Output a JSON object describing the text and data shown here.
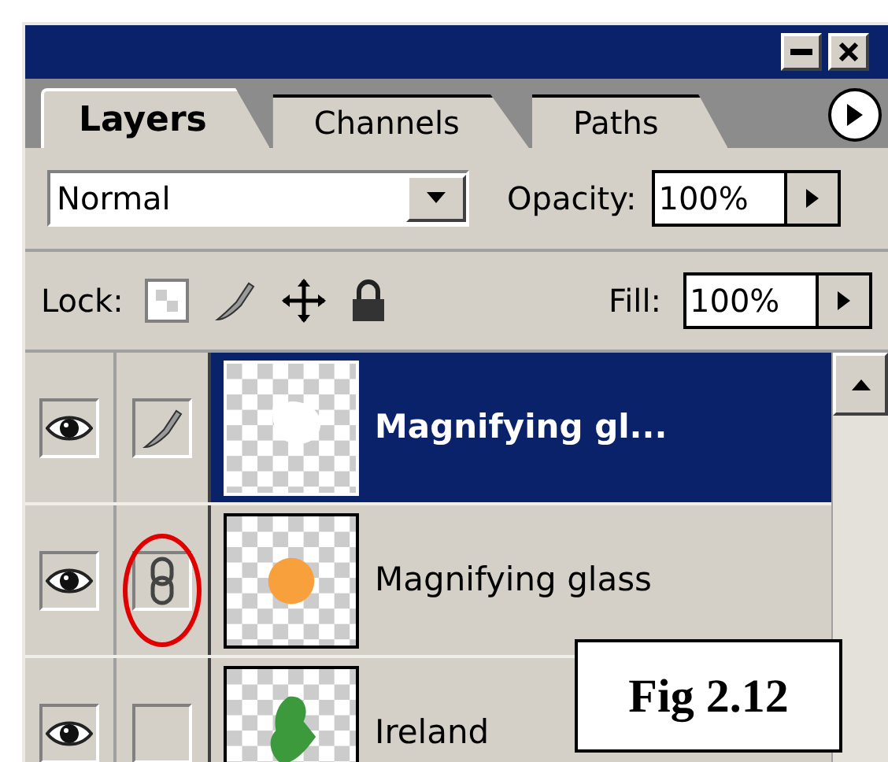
{
  "tabs": [
    {
      "label": "Layers",
      "selected": true
    },
    {
      "label": "Channels",
      "selected": false
    },
    {
      "label": "Paths",
      "selected": false
    }
  ],
  "blend_mode": {
    "value": "Normal"
  },
  "opacity": {
    "label": "Opacity:",
    "value": "100%"
  },
  "lock": {
    "label": "Lock:"
  },
  "fill": {
    "label": "Fill:",
    "value": "100%"
  },
  "layers": [
    {
      "name": "Magnifying gl...",
      "selected": true,
      "visible": true,
      "status": {
        "kind": "brush"
      },
      "thumbnail": {
        "kind": "white"
      },
      "circled": false
    },
    {
      "name": "Magnifying glass",
      "selected": false,
      "visible": true,
      "status": {
        "kind": "link"
      },
      "thumbnail": {
        "kind": "dot"
      },
      "circled": true
    },
    {
      "name": "Ireland",
      "selected": false,
      "visible": true,
      "status": {
        "kind": "empty"
      },
      "thumbnail": {
        "kind": "map"
      },
      "circled": false
    }
  ],
  "figure_label": "Fig 2.12"
}
